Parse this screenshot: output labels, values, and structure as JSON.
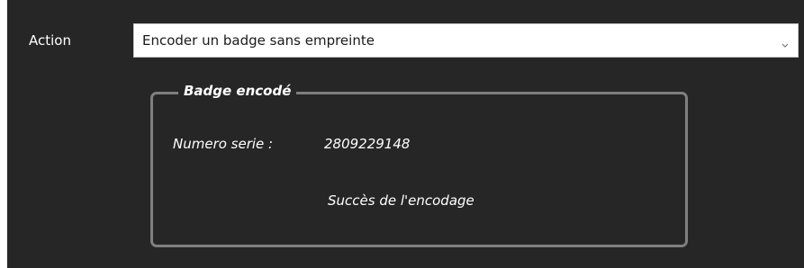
{
  "action": {
    "label": "Action",
    "selected": "Encoder un badge sans empreinte",
    "icon": "chevron-down-icon"
  },
  "badge_group": {
    "title": "Badge encodé",
    "serial_label": "Numero serie :",
    "serial_value": "2809229148",
    "status": "Succès de l'encodage"
  },
  "colors": {
    "background": "#262626",
    "border": "#7f7f7f",
    "text": "#ffffff",
    "select_background": "#ffffff"
  }
}
